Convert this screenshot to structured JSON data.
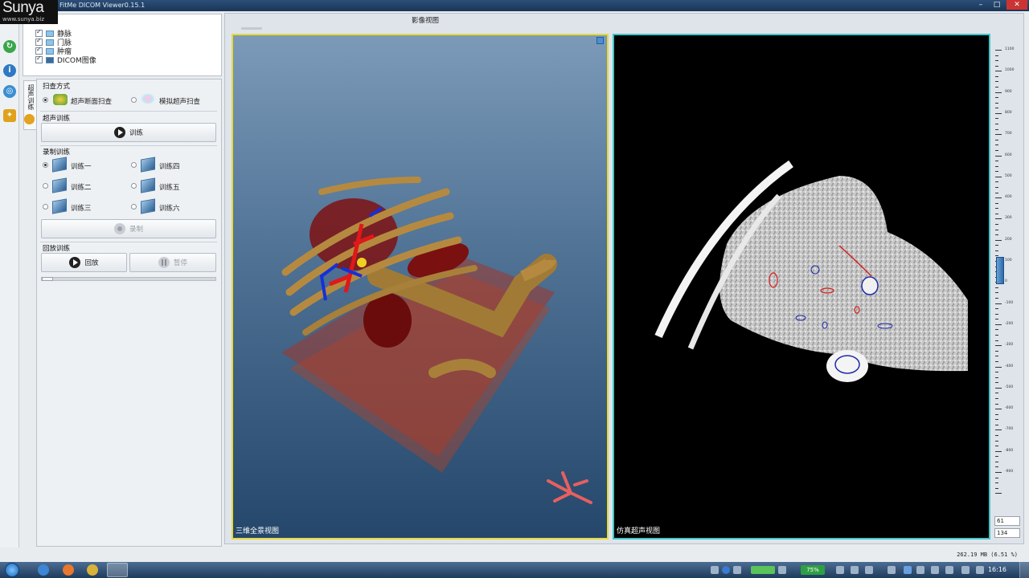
{
  "window": {
    "title": "FitMe DICOM Viewer0.15.1",
    "watermark_brand": "Sunya",
    "watermark_site": "www.sunya.biz",
    "minimize_label": "–",
    "maximize_label": "□",
    "close_label": "✕"
  },
  "layers": [
    {
      "label": "静脉",
      "checked": true
    },
    {
      "label": "门脉",
      "checked": true
    },
    {
      "label": "肿瘤",
      "checked": true
    },
    {
      "label": "DICOM图像",
      "checked": true
    }
  ],
  "side_tab": {
    "label": "超声训练"
  },
  "scan_mode": {
    "title": "扫查方式",
    "options": [
      {
        "label": "超声断面扫查",
        "selected": true
      },
      {
        "label": "模拟超声扫查",
        "selected": false
      }
    ]
  },
  "ultrasound_training": {
    "title": "超声训练",
    "train_button": "训练"
  },
  "record_training": {
    "title": "录制训练",
    "items": [
      {
        "label": "训练一",
        "selected": true
      },
      {
        "label": "训练四",
        "selected": false
      },
      {
        "label": "训练二",
        "selected": false
      },
      {
        "label": "训练五",
        "selected": false
      },
      {
        "label": "训练三",
        "selected": false
      },
      {
        "label": "训练六",
        "selected": false
      }
    ],
    "record_button": "录制"
  },
  "playback_training": {
    "title": "回放训练",
    "play_button": "回放",
    "pause_button": "暂停"
  },
  "view": {
    "title": "影像视图",
    "left_label": "三维全景视图",
    "right_label": "仿真超声视图",
    "highlight_colors": {
      "left_border": "#e8d937",
      "right_border": "#3fc6c9"
    }
  },
  "ruler": {
    "labels": [
      "1100",
      "1000",
      "900",
      "800",
      "700",
      "600",
      "500",
      "400",
      "300",
      "200",
      "100",
      "0",
      "-100",
      "-200",
      "-300",
      "-400",
      "-500",
      "-600",
      "-700",
      "-800",
      "-900"
    ],
    "value_top": "61",
    "value_bottom": "134"
  },
  "status": {
    "memory": "262.19 MB (6.51 %)"
  },
  "taskbar": {
    "battery": "75%",
    "time": "16:16"
  }
}
